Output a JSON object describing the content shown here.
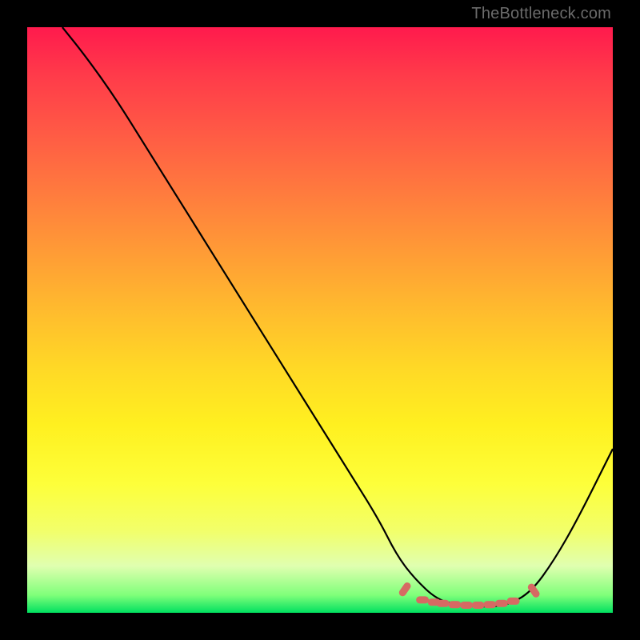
{
  "attribution": "TheBottleneck.com",
  "colors": {
    "frame_bg_top": "#ff1a4d",
    "frame_bg_bottom": "#00e060",
    "curve": "#000000",
    "dots": "#d66a63",
    "page_bg": "#000000",
    "attribution_text": "#6b6b6b"
  },
  "chart_data": {
    "type": "line",
    "title": "",
    "xlabel": "",
    "ylabel": "",
    "xlim": [
      0,
      100
    ],
    "ylim": [
      0,
      100
    ],
    "grid": false,
    "legend": false,
    "series": [
      {
        "name": "bottleneck-curve",
        "x": [
          6,
          10,
          15,
          20,
          25,
          30,
          35,
          40,
          45,
          50,
          55,
          60,
          63,
          66,
          70,
          74,
          78,
          82,
          86,
          90,
          94,
          100
        ],
        "y": [
          100,
          95,
          88,
          80,
          72,
          64,
          56,
          48,
          40,
          32,
          24,
          16,
          10,
          6,
          2.2,
          1.3,
          1.0,
          1.3,
          3.5,
          9,
          16,
          28
        ]
      }
    ],
    "highlight_dots": {
      "name": "optimal-range-dots",
      "x": [
        64.5,
        67.5,
        69.5,
        71,
        73,
        75,
        77,
        79,
        81,
        83,
        86.5
      ],
      "y": [
        4.0,
        2.2,
        1.8,
        1.6,
        1.4,
        1.3,
        1.3,
        1.4,
        1.6,
        2.0,
        3.8
      ]
    }
  }
}
